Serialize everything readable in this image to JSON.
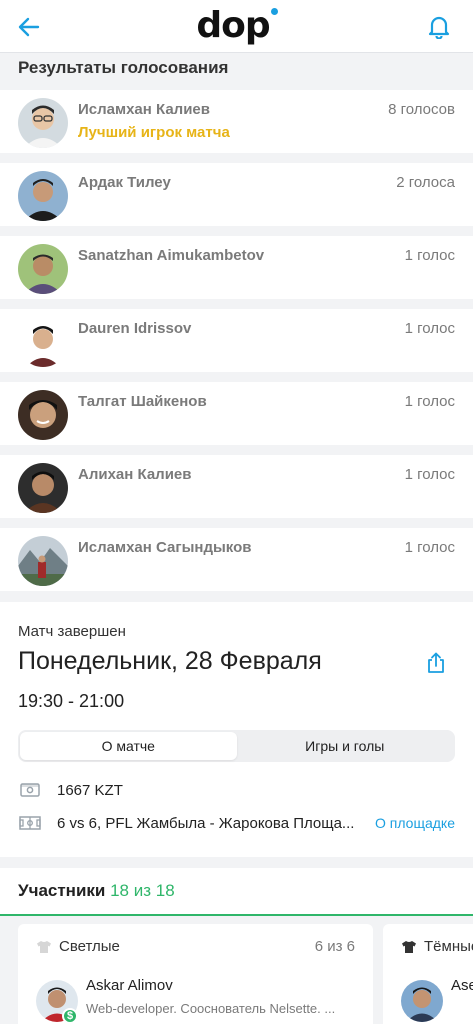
{
  "header": {
    "logo_text": "dop",
    "back_icon": "arrow-left-icon",
    "bell_icon": "bell-icon",
    "accent_color": "#1a9fe0"
  },
  "votes": {
    "title": "Результаты голосования",
    "items": [
      {
        "name": "Исламхан Калиев",
        "subtitle": "Лучший игрок матча",
        "count": "8 голосов",
        "avatar_color": "#c9d3da"
      },
      {
        "name": "Ардак Тилеу",
        "subtitle": "",
        "count": "2 голоса",
        "avatar_color": "#7fa3c4"
      },
      {
        "name": "Sanatzhan Aimukambetov",
        "subtitle": "",
        "count": "1 голос",
        "avatar_color": "#8fb46a"
      },
      {
        "name": "Dauren Idrissov",
        "subtitle": "",
        "count": "1 голос",
        "avatar_color": "#e9e4df"
      },
      {
        "name": "Талгат Шайкенов",
        "subtitle": "",
        "count": "1 голос",
        "avatar_color": "#4a3a30"
      },
      {
        "name": "Алихан Калиев",
        "subtitle": "",
        "count": "1 голос",
        "avatar_color": "#3b3b3b"
      },
      {
        "name": "Исламхан Сагындыков",
        "subtitle": "",
        "count": "1 голос",
        "avatar_color": "#9aa8b2"
      }
    ],
    "highlight_color": "#e7b418"
  },
  "match": {
    "status": "Матч завершен",
    "date": "Понедельник, 28 Февраля",
    "time": "19:30 - 21:00",
    "tabs": [
      "О матче",
      "Игры и голы"
    ],
    "active_tab": "О матче",
    "price": "1667 KZT",
    "venue": "6 vs 6, PFL Жамбыла - Жарокова Площа...",
    "venue_link": "О площадке",
    "share_icon": "share-icon",
    "price_icon": "money-icon",
    "venue_icon": "field-icon"
  },
  "participants": {
    "title": "Участники",
    "count": "18 из 18",
    "accent_color": "#2fb66a",
    "teams": [
      {
        "name": "Светлые",
        "count": "6 из 6",
        "shirt_color": "#d6d6d6",
        "player_name": "Askar Alimov",
        "player_desc": "Web-developer. Сооснователь Nelsette. ...",
        "badge": "$"
      },
      {
        "name": "Тёмные",
        "count": "",
        "shirt_color": "#333333",
        "player_name": "Ase",
        "player_desc": "",
        "badge": ""
      }
    ]
  }
}
